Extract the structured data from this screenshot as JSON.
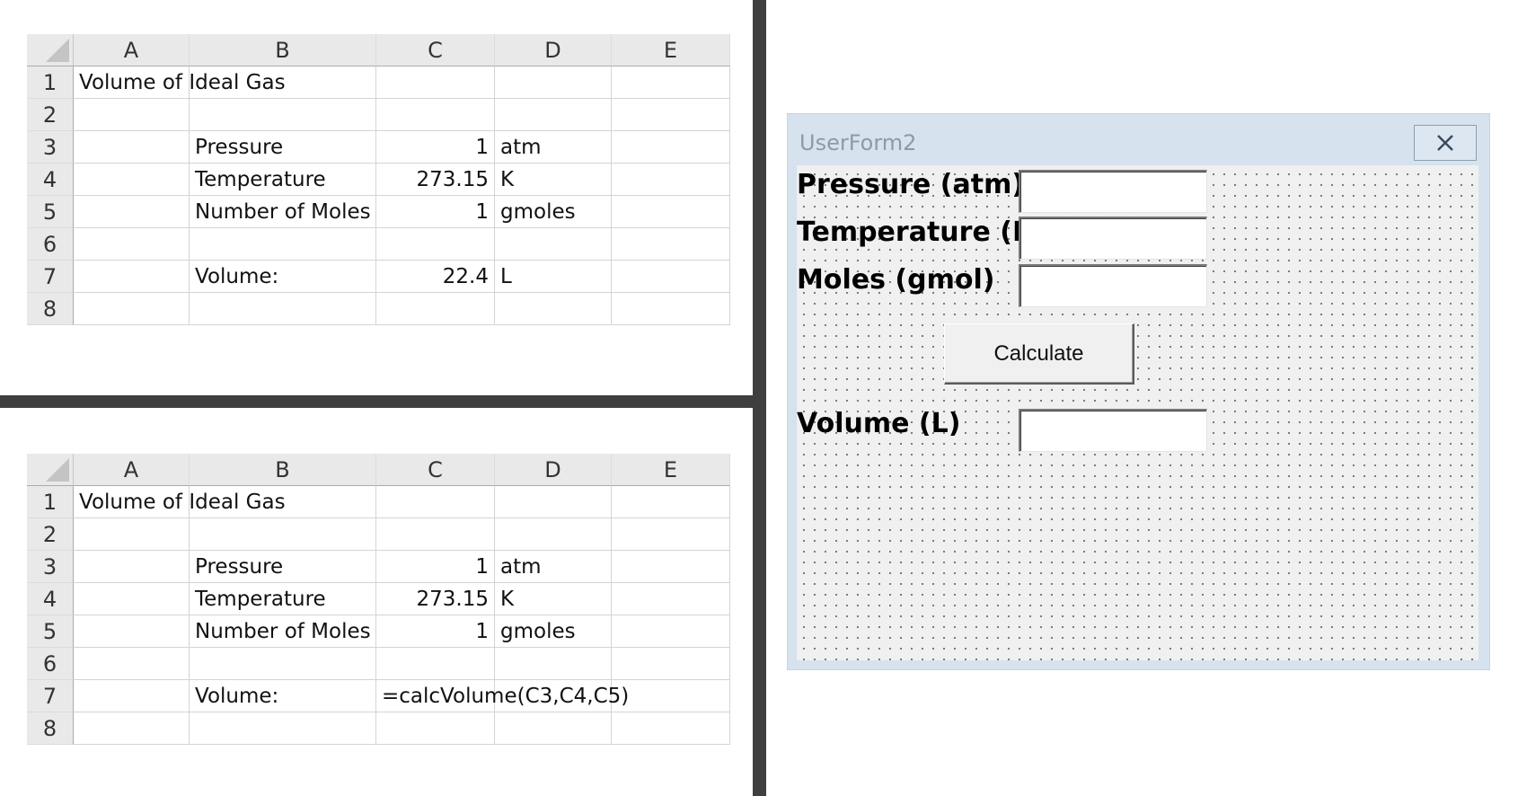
{
  "sheets": [
    {
      "columns": [
        "A",
        "B",
        "C",
        "D",
        "E"
      ],
      "rows": [
        {
          "num": "1",
          "a": "Volume of Ideal Gas",
          "b": "",
          "c": "",
          "d": "",
          "e": ""
        },
        {
          "num": "2",
          "a": "",
          "b": "",
          "c": "",
          "d": "",
          "e": ""
        },
        {
          "num": "3",
          "a": "",
          "b": "Pressure",
          "c": "1",
          "d": "atm",
          "e": ""
        },
        {
          "num": "4",
          "a": "",
          "b": "Temperature",
          "c": "273.15",
          "d": "K",
          "e": ""
        },
        {
          "num": "5",
          "a": "",
          "b": "Number of Moles",
          "c": "1",
          "d": "gmoles",
          "e": ""
        },
        {
          "num": "6",
          "a": "",
          "b": "",
          "c": "",
          "d": "",
          "e": ""
        },
        {
          "num": "7",
          "a": "",
          "b": "Volume:",
          "c": "22.4",
          "d": "L",
          "e": ""
        },
        {
          "num": "8",
          "a": "",
          "b": "",
          "c": "",
          "d": "",
          "e": ""
        }
      ]
    },
    {
      "columns": [
        "A",
        "B",
        "C",
        "D",
        "E"
      ],
      "rows": [
        {
          "num": "1",
          "a": "Volume of Ideal Gas",
          "b": "",
          "c": "",
          "d": "",
          "e": ""
        },
        {
          "num": "2",
          "a": "",
          "b": "",
          "c": "",
          "d": "",
          "e": ""
        },
        {
          "num": "3",
          "a": "",
          "b": "Pressure",
          "c": "1",
          "d": "atm",
          "e": ""
        },
        {
          "num": "4",
          "a": "",
          "b": "Temperature",
          "c": "273.15",
          "d": "K",
          "e": ""
        },
        {
          "num": "5",
          "a": "",
          "b": "Number of Moles",
          "c": "1",
          "d": "gmoles",
          "e": ""
        },
        {
          "num": "6",
          "a": "",
          "b": "",
          "c": "",
          "d": "",
          "e": ""
        },
        {
          "num": "7",
          "a": "",
          "b": "Volume:",
          "c": "=calcVolume(C3,C4,C5)",
          "d": "",
          "e": ""
        },
        {
          "num": "8",
          "a": "",
          "b": "",
          "c": "",
          "d": "",
          "e": ""
        }
      ]
    }
  ],
  "userform": {
    "title": "UserForm2",
    "close_icon": "close-icon",
    "labels": {
      "pressure": "Pressure (atm)",
      "temperature": "Temperature (K)",
      "moles": "Moles (gmol)",
      "volume": "Volume (L)"
    },
    "inputs": {
      "pressure": "",
      "temperature": "",
      "moles": "",
      "volume": ""
    },
    "calculate_label": "Calculate"
  },
  "colors": {
    "divider": "#3f3f3f",
    "header_bg": "#e9e9e9",
    "form_frame": "#d6e2ee",
    "form_client": "#f0f0f0"
  }
}
